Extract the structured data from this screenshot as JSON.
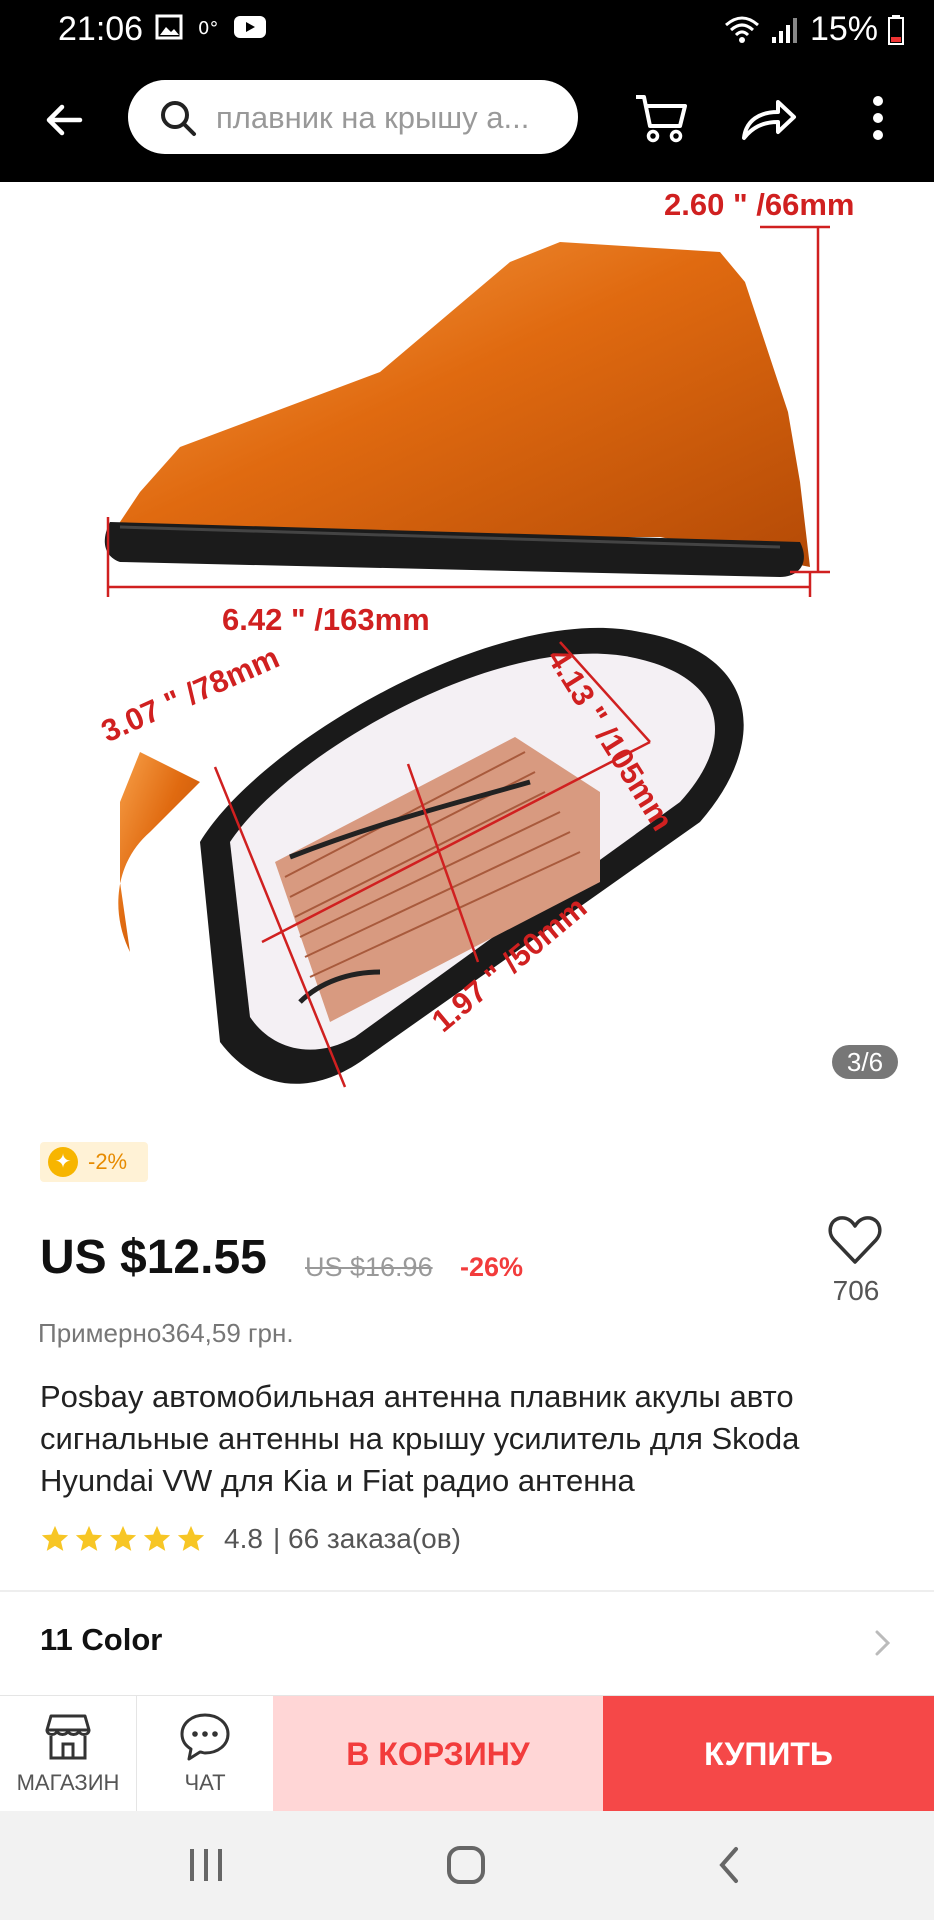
{
  "status_bar": {
    "time": "21:06",
    "battery": "15%"
  },
  "toolbar": {
    "search_placeholder": "плавник на крышу а..."
  },
  "gallery": {
    "dimensions": {
      "height": "2.60 \" /66mm",
      "length": "6.42 \" /163mm",
      "width": "3.07 \" /78mm",
      "inner_length": "4.13 \" /105mm",
      "inner_width": "1.97 \" /50mm"
    },
    "counter": "3/6",
    "product_color": "#e06a10"
  },
  "coupon": {
    "text": "-2%"
  },
  "price": {
    "current": "US $12.55",
    "original": "US $16.96",
    "discount": "-26%",
    "approx": "Примерно364,59 грн."
  },
  "wishlist": {
    "count": "706"
  },
  "product": {
    "title": "Posbay автомобильная антенна плавник акулы авто сигнальные антенны на крышу усилитель для Skoda Hyundai VW для Kia и Fiat радио антенна",
    "rating": "4.8",
    "orders": "| 66 заказа(ов)",
    "stars": 5
  },
  "variant": {
    "label": "11 Color"
  },
  "bottom_bar": {
    "store_label": "МАГАЗИН",
    "chat_label": "ЧАТ",
    "cart_label": "В КОРЗИНУ",
    "buy_label": "КУПИТЬ"
  },
  "colors": {
    "accent": "#f54848",
    "cart_bg": "#ffd6d6",
    "star": "#f7c625"
  }
}
